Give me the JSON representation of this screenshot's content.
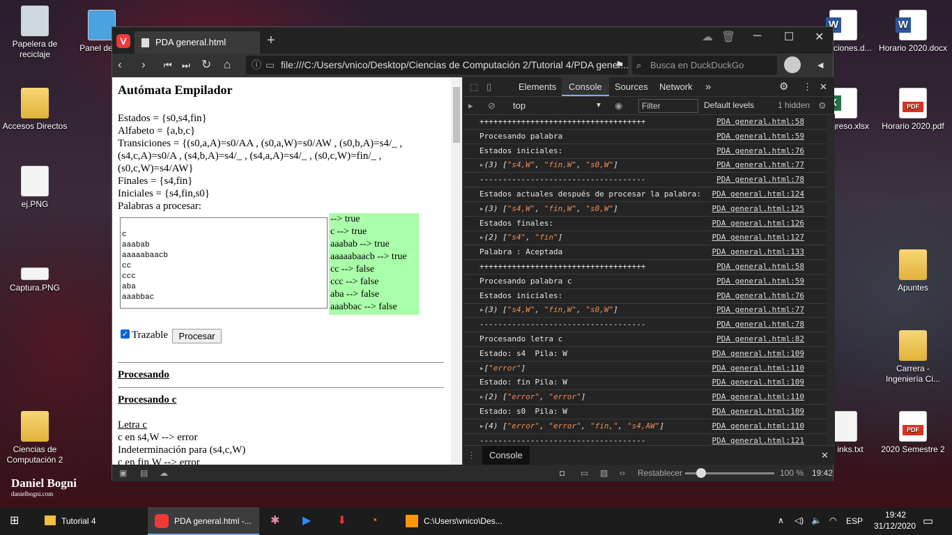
{
  "desktop": {
    "icons": [
      {
        "label": "Papelera de reciclaje"
      },
      {
        "label": "Panel de co"
      },
      {
        "label": "Accesos Directos"
      },
      {
        "label": "ej.PNG"
      },
      {
        "label": "Captura.PNG"
      },
      {
        "label": "Ciencias de Computación 2"
      },
      {
        "label": "aciones.d..."
      },
      {
        "label": "Horario 2020.docx"
      },
      {
        "label": "greso.xlsx"
      },
      {
        "label": "Horario 2020.pdf"
      },
      {
        "label": "Apuntes"
      },
      {
        "label": "Carrera - Ingeniería Ci..."
      },
      {
        "label": "inks.txt"
      },
      {
        "label": "2020 Semestre 2"
      }
    ],
    "brand": {
      "name": "Daniel Bogni",
      "site": "danielbogni.com"
    }
  },
  "browser": {
    "tab_title": "PDA general.html",
    "url": "file:///C:/Users/vnico/Desktop/Ciencias de Computación 2/Tutorial 4/PDA gener...",
    "search_placeholder": "Busca en DuckDuckGo",
    "status": {
      "reset": "Restablecer",
      "zoom": "100 %",
      "time": "19:42"
    }
  },
  "page": {
    "title": "Autómata Empilador",
    "lines": [
      "Estados = {s0,s4,fin}",
      "Alfabeto = {a,b,c}",
      "Transiciones = {(s0,a,A)=s0/AA , (s0,a,W)=s0/AW , (s0,b,A)=s4/_ ,",
      "(s4,c,A)=s0/A , (s4,b,A)=s4/_ , (s4,a,A)=s4/_ , (s0,c,W)=fin/_ ,",
      "(s0,c,W)=s4/AW}",
      "Finales = {s4,fin}",
      "Iniciales = {s4,fin,s0}",
      "Palabras a procesar:"
    ],
    "textarea_lines": [
      "",
      "c",
      "aaabab",
      "aaaaabaacb",
      "cc",
      "ccc",
      "aba",
      "aaabbac"
    ],
    "results": [
      "--> true",
      "c --> true",
      "aaabab --> true",
      "aaaaabaacb --> true",
      "cc --> false",
      "ccc --> false",
      "aba --> false",
      "aaabbac --> false"
    ],
    "trazable_label": "Trazable",
    "procesar_label": "Procesar",
    "procesando": "Procesando",
    "procesando_c": "Procesando c",
    "letra": "Letra c",
    "log": [
      "c en s4,W --> error",
      "Indeterminación para (s4,c,W)",
      "c en fin,W --> error"
    ]
  },
  "devtools": {
    "tabs": [
      "Elements",
      "Console",
      "Sources",
      "Network"
    ],
    "more": "»",
    "context": "top",
    "filter_placeholder": "Filter",
    "levels": "Default levels",
    "hidden": "1 hidden",
    "drawer_tab": "Console",
    "console": [
      {
        "msg": "++++++++++++++++++++++++++++++++++++",
        "src": "PDA general.html:58"
      },
      {
        "msg": "Procesando palabra",
        "src": "PDA general.html:59"
      },
      {
        "msg": "Estados iniciales:",
        "src": "PDA general.html:76"
      },
      {
        "count": "(3)",
        "items": [
          "\"s4,W\"",
          "\"fin,W\"",
          "\"s0,W\""
        ],
        "src": "PDA general.html:77"
      },
      {
        "msg": "------------------------------------",
        "src": "PDA general.html:78"
      },
      {
        "msg": "Estados actuales después de procesar la palabra:",
        "src": "PDA general.html:124"
      },
      {
        "count": "(3)",
        "items": [
          "\"s4,W\"",
          "\"fin,W\"",
          "\"s0,W\""
        ],
        "src": "PDA general.html:125"
      },
      {
        "msg": "Estados finales:",
        "src": "PDA general.html:126"
      },
      {
        "count": "(2)",
        "items": [
          "\"s4\"",
          "\"fin\""
        ],
        "src": "PDA general.html:127"
      },
      {
        "msg": "Palabra : Aceptada",
        "src": "PDA general.html:133"
      },
      {
        "msg": "++++++++++++++++++++++++++++++++++++",
        "src": "PDA general.html:58"
      },
      {
        "msg": "Procesando palabra c",
        "src": "PDA general.html:59"
      },
      {
        "msg": "Estados iniciales:",
        "src": "PDA general.html:76"
      },
      {
        "count": "(3)",
        "items": [
          "\"s4,W\"",
          "\"fin,W\"",
          "\"s0,W\""
        ],
        "src": "PDA general.html:77"
      },
      {
        "msg": "------------------------------------",
        "src": "PDA general.html:78"
      },
      {
        "msg": "Procesando letra c",
        "src": "PDA general.html:82"
      },
      {
        "msg": "Estado: s4  Pila: W",
        "src": "PDA general.html:109"
      },
      {
        "count": "",
        "items": [
          "\"error\""
        ],
        "src": "PDA general.html:110"
      },
      {
        "msg": "Estado: fin Pila: W",
        "src": "PDA general.html:109"
      },
      {
        "count": "(2)",
        "items": [
          "\"error\"",
          "\"error\""
        ],
        "src": "PDA general.html:110"
      },
      {
        "msg": "Estado: s0  Pila: W",
        "src": "PDA general.html:109"
      },
      {
        "count": "(4)",
        "items": [
          "\"error\"",
          "\"error\"",
          "\"fin,\"",
          "\"s4,AW\""
        ],
        "src": "PDA general.html:110"
      },
      {
        "msg": "------------------------------------",
        "src": "PDA general.html:121"
      }
    ]
  },
  "taskbar": {
    "items": [
      {
        "label": "Tutorial 4"
      },
      {
        "label": "PDA general.html -..."
      },
      {
        "label": "C:\\Users\\vnico\\Des..."
      }
    ],
    "lang": "ESP",
    "time": "19:42",
    "date": "31/12/2020"
  }
}
